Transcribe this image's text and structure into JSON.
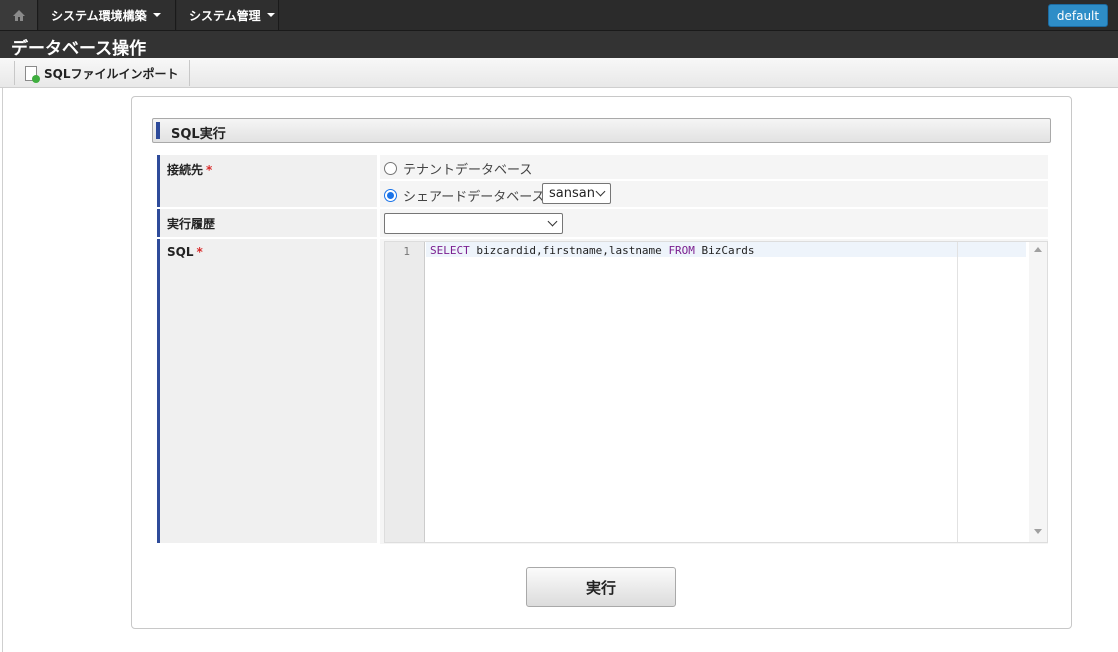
{
  "nav": {
    "home_icon": "home-icon",
    "menus": [
      {
        "label": "システム環境構築"
      },
      {
        "label": "システム管理"
      }
    ],
    "tenant_button": "default"
  },
  "page": {
    "title": "データベース操作"
  },
  "toolbar": {
    "import_label": "SQLファイルインポート"
  },
  "section": {
    "title": "SQL実行"
  },
  "form": {
    "connection": {
      "label": "接続先",
      "required_mark": "*",
      "options": [
        {
          "label": "テナントデータベース",
          "selected": false
        },
        {
          "label": "シェアードデータベース",
          "selected": true
        }
      ],
      "shared_db_select": "sansan"
    },
    "history": {
      "label": "実行履歴",
      "value": ""
    },
    "sql": {
      "label": "SQL",
      "required_mark": "*",
      "line_number": "1",
      "code_kw1": "SELECT",
      "code_mid": " bizcardid,firstname,lastname ",
      "code_kw2": "FROM",
      "code_tail": " BizCards"
    }
  },
  "actions": {
    "execute_label": "実行"
  },
  "colors": {
    "accent": "#2e4b9a",
    "default_button": "#2e8dc7",
    "required": "#d92b2b"
  }
}
